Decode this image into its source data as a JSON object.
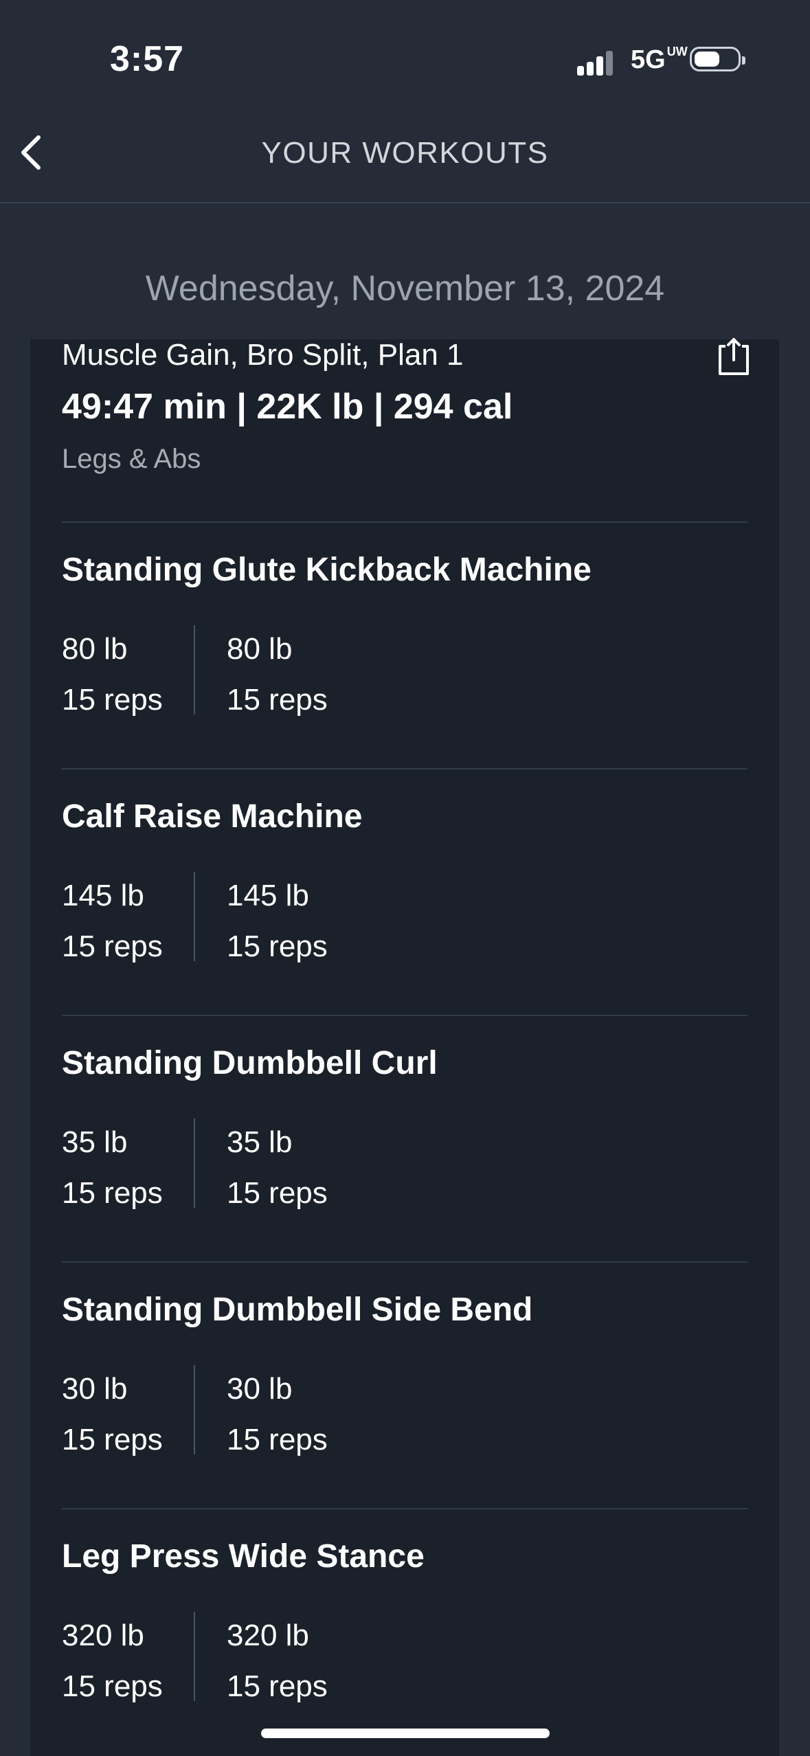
{
  "status_bar": {
    "time": "3:57",
    "network": "5G",
    "network_sup": "UW"
  },
  "nav": {
    "title": "YOUR WORKOUTS"
  },
  "date": "Wednesday, November 13, 2024",
  "workout": {
    "plan_name": "Muscle Gain, Bro Split, Plan 1",
    "summary": "49:47 min | 22K lb | 294 cal",
    "subtitle": "Legs & Abs"
  },
  "exercises": [
    {
      "name": "Standing Glute Kickback Machine",
      "sets": [
        {
          "weight": "80 lb",
          "reps": "15 reps"
        },
        {
          "weight": "80 lb",
          "reps": "15 reps"
        }
      ]
    },
    {
      "name": "Calf Raise Machine",
      "sets": [
        {
          "weight": "145 lb",
          "reps": "15 reps"
        },
        {
          "weight": "145 lb",
          "reps": "15 reps"
        }
      ]
    },
    {
      "name": "Standing Dumbbell Curl",
      "sets": [
        {
          "weight": "35 lb",
          "reps": "15 reps"
        },
        {
          "weight": "35 lb",
          "reps": "15 reps"
        }
      ]
    },
    {
      "name": "Standing Dumbbell Side Bend",
      "sets": [
        {
          "weight": "30 lb",
          "reps": "15 reps"
        },
        {
          "weight": "30 lb",
          "reps": "15 reps"
        }
      ]
    },
    {
      "name": "Leg Press Wide Stance",
      "sets": [
        {
          "weight": "320 lb",
          "reps": "15 reps"
        },
        {
          "weight": "320 lb",
          "reps": "15 reps"
        }
      ]
    }
  ],
  "colors": {
    "background": "#252c38",
    "card": "#1b212a",
    "muted_text": "#9ea4ad"
  }
}
